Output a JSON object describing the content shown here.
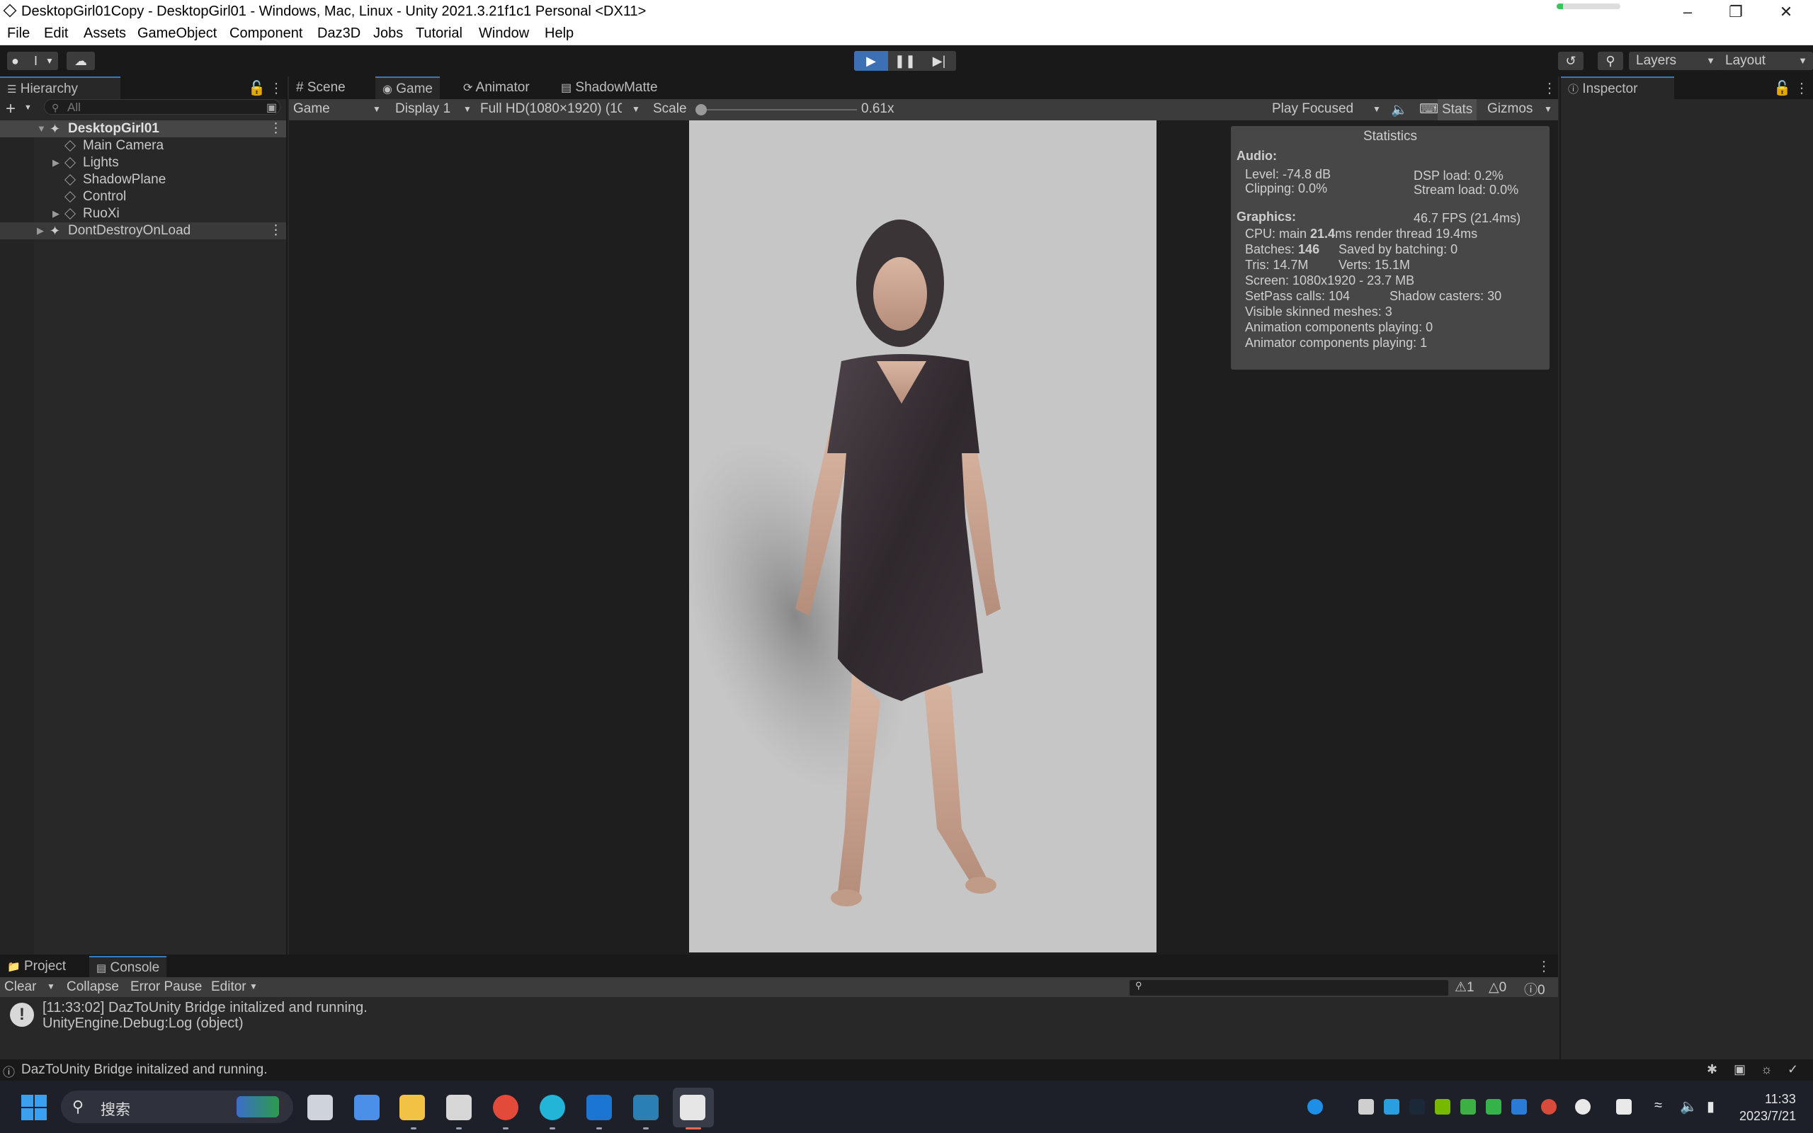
{
  "window": {
    "title": "DesktopGirl01Copy - DesktopGirl01 - Windows, Mac, Linux - Unity 2021.3.21f1c1 Personal <DX11>",
    "progress_fraction": 0.1
  },
  "menu": [
    "File",
    "Edit",
    "Assets",
    "GameObject",
    "Component",
    "Daz3D",
    "Jobs",
    "Tutorial",
    "Window",
    "Help"
  ],
  "toolbar": {
    "account_label": "I",
    "layers_label": "Layers",
    "layout_label": "Layout"
  },
  "hierarchy": {
    "tab_label": "Hierarchy",
    "search_placeholder": "All",
    "items": [
      {
        "label": "DesktopGirl01",
        "scene": true,
        "bold": true
      },
      {
        "label": "Main Camera"
      },
      {
        "label": "Lights",
        "expandable": true
      },
      {
        "label": "ShadowPlane"
      },
      {
        "label": "Control"
      },
      {
        "label": "RuoXi",
        "expandable": true
      },
      {
        "label": "DontDestroyOnLoad",
        "scene": true
      }
    ]
  },
  "tabs": [
    "Scene",
    "Game",
    "Animator",
    "ShadowMatte"
  ],
  "game_toolbar": {
    "mode": "Game",
    "display": "Display 1",
    "resolution": "Full HD(1080×1920) (10",
    "scale_label": "Scale",
    "scale_value": "0.61x",
    "play_focused": "Play Focused",
    "stats": "Stats",
    "gizmos": "Gizmos"
  },
  "statistics": {
    "title": "Statistics",
    "audio_label": "Audio:",
    "level": "Level: -74.8 dB",
    "dsp_load": "DSP load: 0.2%",
    "clipping": "Clipping: 0.0%",
    "stream_load": "Stream load: 0.0%",
    "graphics_label": "Graphics:",
    "fps": "46.7 FPS (21.4ms)",
    "cpu_prefix": "CPU: main ",
    "cpu_main": "21.4",
    "cpu_suffix": "ms  render thread 19.4ms",
    "batches_prefix": "Batches: ",
    "batches": "146",
    "saved_batching": "Saved by batching: 0",
    "tris": "Tris: 14.7M",
    "verts": "Verts: 15.1M",
    "screen": "Screen: 1080x1920 - 23.7 MB",
    "setpass": "SetPass calls: 104",
    "shadow_casters": "Shadow casters: 30",
    "skinned": "Visible skinned meshes: 3",
    "animation": "Animation components playing: 0",
    "animator": "Animator components playing: 1"
  },
  "inspector": {
    "tab_label": "Inspector"
  },
  "console": {
    "tabs": [
      "Project",
      "Console"
    ],
    "clear": "Clear",
    "collapse": "Collapse",
    "error_pause": "Error Pause",
    "editor": "Editor",
    "counts": [
      "1",
      "0",
      "0"
    ],
    "log_line1": "[11:33:02] DazToUnity Bridge initalized and running.",
    "log_line2": "UnityEngine.Debug:Log (object)"
  },
  "status": {
    "message": "DazToUnity Bridge initalized and running."
  },
  "taskbar": {
    "search_placeholder": "搜索",
    "time": "11:33",
    "date": "2023/7/21"
  },
  "colors": {
    "accent": "#3d6fb5",
    "panel": "#282828",
    "dark": "#191919",
    "game_bg": "#c6c6c6"
  }
}
